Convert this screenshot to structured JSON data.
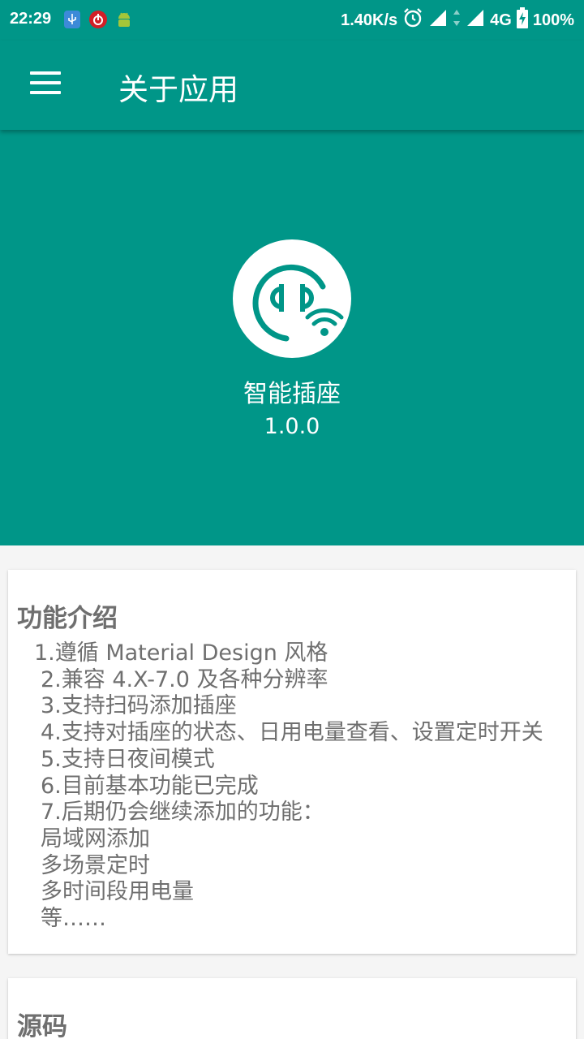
{
  "status_bar": {
    "time": "22:29",
    "net_speed": "1.40K/s",
    "network": "4G",
    "battery": "100%",
    "icons": [
      "usb-icon",
      "music-icon",
      "android-icon",
      "alarm-icon",
      "signal-icon",
      "data-arrows-icon",
      "signal-icon",
      "battery-charging-icon"
    ]
  },
  "toolbar": {
    "title": "关于应用",
    "menu_icon": "hamburger-menu-icon"
  },
  "app": {
    "name": "智能插座",
    "version": "1.0.0",
    "logo_icon": "smart-socket-wifi-icon"
  },
  "features": {
    "title": "功能介绍",
    "lines": [
      "1.遵循 Material Design 风格",
      "2.兼容 4.X-7.0 及各种分辨率",
      "3.支持扫码添加插座",
      "4.支持对插座的状态、日用电量查看、设置定时开关",
      "5.支持日夜间模式",
      "6.目前基本功能已完成",
      "7.后期仍会继续添加的功能：",
      "局域网添加",
      "多场景定时",
      "多时间段用电量",
      "等……"
    ]
  },
  "source": {
    "title": "源码"
  },
  "colors": {
    "primary": "#009688",
    "card_text": "#6f6f6f",
    "background": "#f5f5f5"
  }
}
